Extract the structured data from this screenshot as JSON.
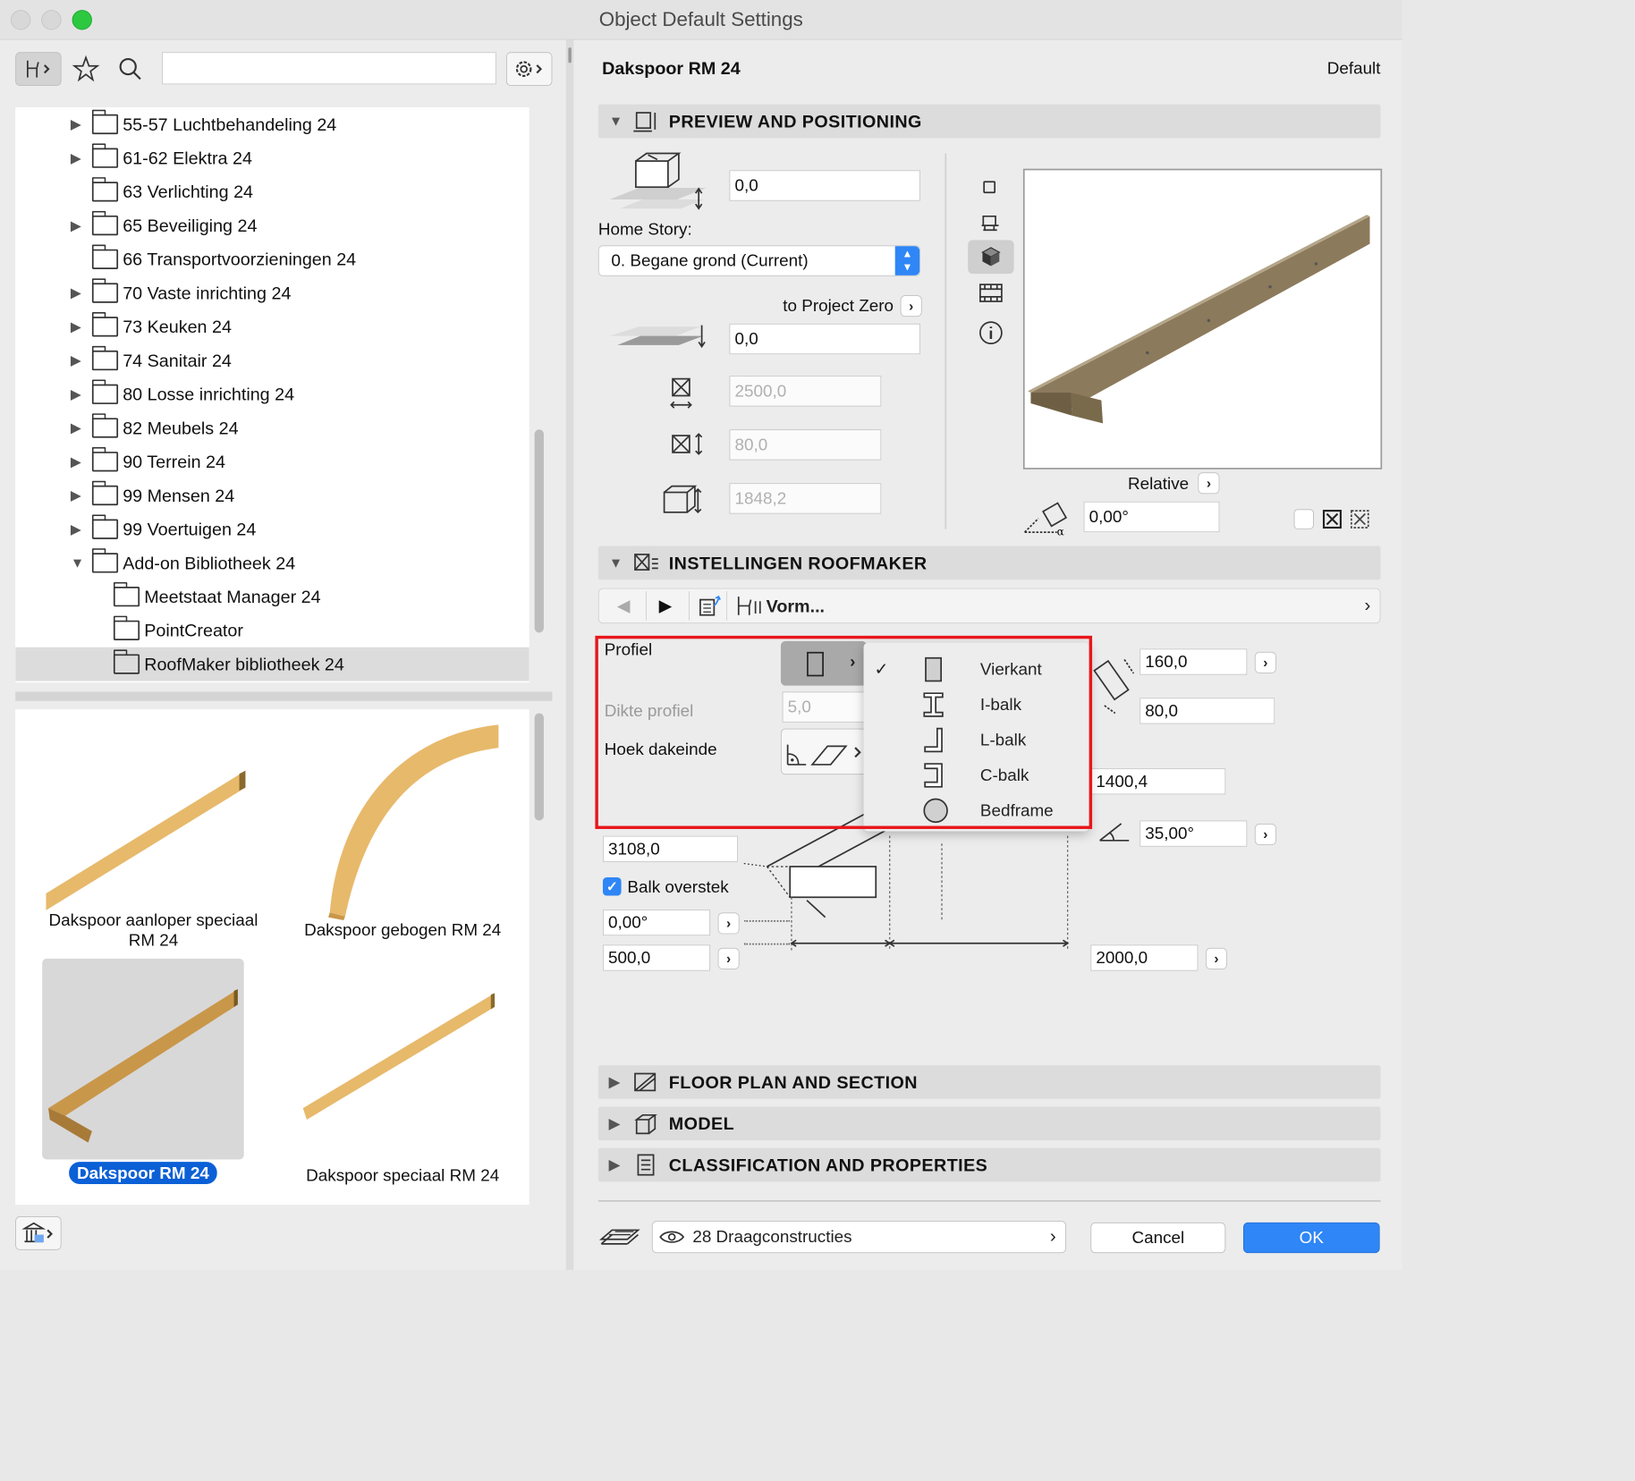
{
  "window": {
    "title": "Object Default Settings"
  },
  "search": {
    "placeholder": ""
  },
  "tree": [
    {
      "label": "55-57 Luchtbehandeling 24",
      "expandable": true,
      "expanded": false,
      "indent": 0
    },
    {
      "label": "61-62 Elektra 24",
      "expandable": true,
      "expanded": false,
      "indent": 0
    },
    {
      "label": "63 Verlichting 24",
      "expandable": false,
      "expanded": false,
      "indent": 0
    },
    {
      "label": "65 Beveiliging 24",
      "expandable": true,
      "expanded": false,
      "indent": 0
    },
    {
      "label": "66 Transportvoorzieningen 24",
      "expandable": false,
      "expanded": false,
      "indent": 0
    },
    {
      "label": "70 Vaste inrichting 24",
      "expandable": true,
      "expanded": false,
      "indent": 0
    },
    {
      "label": "73 Keuken 24",
      "expandable": true,
      "expanded": false,
      "indent": 0
    },
    {
      "label": "74 Sanitair 24",
      "expandable": true,
      "expanded": false,
      "indent": 0
    },
    {
      "label": "80 Losse inrichting 24",
      "expandable": true,
      "expanded": false,
      "indent": 0
    },
    {
      "label": "82 Meubels 24",
      "expandable": true,
      "expanded": false,
      "indent": 0
    },
    {
      "label": "90 Terrein 24",
      "expandable": true,
      "expanded": false,
      "indent": 0
    },
    {
      "label": "99 Mensen 24",
      "expandable": true,
      "expanded": false,
      "indent": 0
    },
    {
      "label": "99 Voertuigen 24",
      "expandable": true,
      "expanded": false,
      "indent": 0
    },
    {
      "label": "Add-on Bibliotheek 24",
      "expandable": true,
      "expanded": true,
      "indent": 0
    },
    {
      "label": "Meetstaat Manager 24",
      "expandable": false,
      "expanded": false,
      "indent": 1
    },
    {
      "label": "PointCreator",
      "expandable": false,
      "expanded": false,
      "indent": 1
    },
    {
      "label": "RoofMaker bibliotheek 24",
      "expandable": false,
      "expanded": false,
      "indent": 1,
      "selected": true
    }
  ],
  "gallery": {
    "item1": "Dakspoor aanloper speciaal\nRM 24",
    "item2": "Dakspoor gebogen RM 24",
    "item3": "Dakspoor RM 24",
    "item4": "Dakspoor speciaal RM 24"
  },
  "header": {
    "object_name": "Dakspoor RM 24",
    "default_label": "Default"
  },
  "sections": {
    "preview": "PREVIEW AND POSITIONING",
    "roofmaker": "INSTELLINGEN ROOFMAKER",
    "floorplan": "FLOOR PLAN AND SECTION",
    "model": "MODEL",
    "classification": "CLASSIFICATION AND PROPERTIES"
  },
  "positioning": {
    "elevation": "0,0",
    "home_story_label": "Home Story:",
    "home_story_value": "0. Begane grond (Current)",
    "to_project_zero": "to Project Zero",
    "project_zero_value": "0,0",
    "width": "2500,0",
    "height": "80,0",
    "depth": "1848,2",
    "relative_label": "Relative",
    "angle": "0,00°"
  },
  "roofmaker": {
    "page_selector": "Vorm...",
    "profiel_label": "Profiel",
    "dikte_label": "Dikte profiel",
    "dikte_value": "5,0",
    "hoek_label": "Hoek dakeinde",
    "size1": "160,0",
    "size2": "80,0",
    "value_1400": "1400,4",
    "angle_35": "35,00°",
    "value_3108": "3108,0",
    "balk_overstek_label": "Balk overstek",
    "balk_overstek_checked": true,
    "overstek_angle": "0,00°",
    "overstek_len": "500,0",
    "len_2000": "2000,0"
  },
  "profile_menu": [
    {
      "label": "Vierkant",
      "checked": true,
      "icon": "square-profile-icon"
    },
    {
      "label": "I-balk",
      "checked": false,
      "icon": "i-beam-profile-icon"
    },
    {
      "label": "L-balk",
      "checked": false,
      "icon": "l-beam-profile-icon"
    },
    {
      "label": "C-balk",
      "checked": false,
      "icon": "c-beam-profile-icon"
    },
    {
      "label": "Bedframe",
      "checked": false,
      "icon": "circle-profile-icon"
    }
  ],
  "footer": {
    "layer": "28 Draagconstructies",
    "cancel": "Cancel",
    "ok": "OK"
  },
  "colors": {
    "accent": "#2f86f6",
    "highlight": "#e8161b",
    "wood": "#e7b96b"
  }
}
